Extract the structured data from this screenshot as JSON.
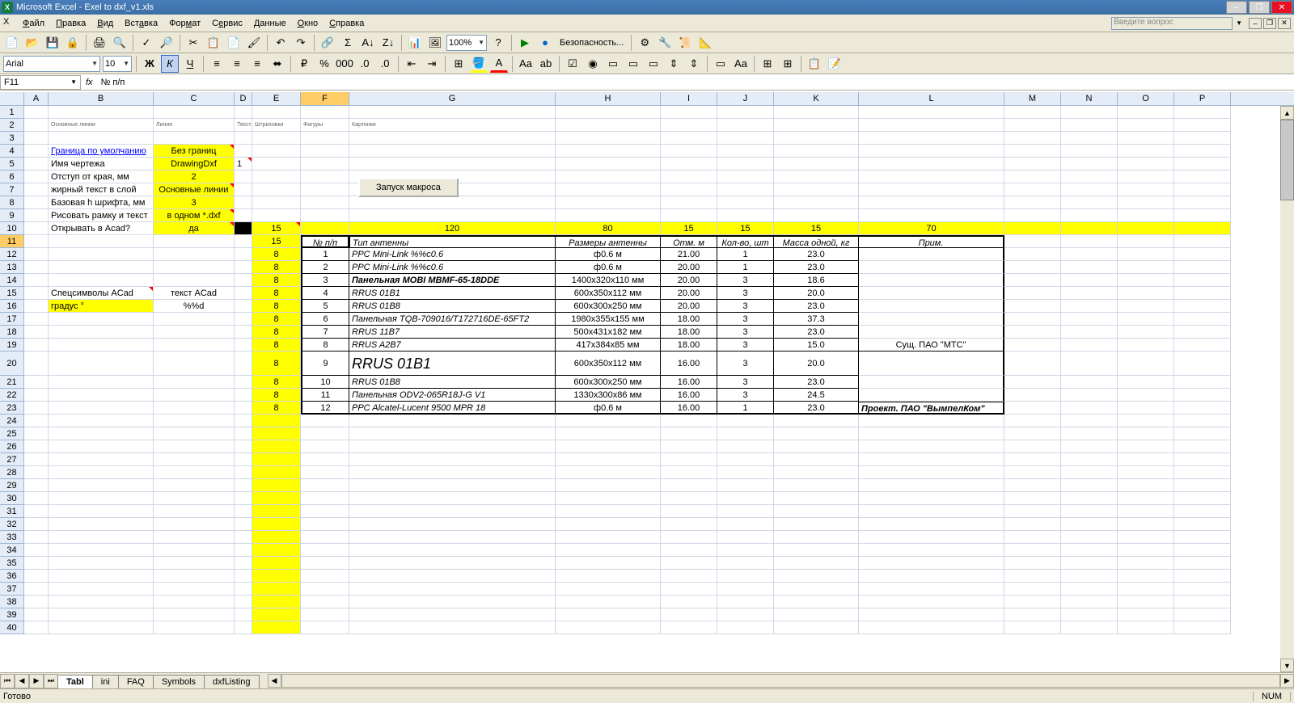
{
  "title": "Microsoft Excel - Exel to dxf_v1.xls",
  "menu": [
    "Файл",
    "Правка",
    "Вид",
    "Вставка",
    "Формат",
    "Сервис",
    "Данные",
    "Окно",
    "Справка"
  ],
  "question_placeholder": "Введите вопрос",
  "font_name": "Arial",
  "font_size": "10",
  "zoom": "100%",
  "security_label": "Безопасность...",
  "name_box": "F11",
  "formula": "№ п/п",
  "col_letters": [
    "A",
    "B",
    "C",
    "D",
    "E",
    "F",
    "G",
    "H",
    "I",
    "J",
    "K",
    "L",
    "M",
    "N",
    "O",
    "P"
  ],
  "tinyB2": "Основные линии",
  "tinyC2": "Линии",
  "tinyD2": "Текст",
  "tinyE2": "Штриховки",
  "tinyF2": "Фигуры",
  "tinyG2": "Картинки",
  "b4": "Граница по умолчанию",
  "c4": "Без границ",
  "b5": "Имя чертежа",
  "c5": "DrawingDxf",
  "d5": "1",
  "b6": "Отступ от края, мм",
  "c6": "2",
  "b7": "жирный текст в слой",
  "c7": "Основные линии",
  "b8": "Базовая h шрифта, мм",
  "c8": "3",
  "b9": "Рисовать рамку и текст",
  "c9": "в одном *.dxf",
  "b10": "Открывать в Acad?",
  "c10": "да",
  "b15": "Спецсимволы ACad",
  "c15": "текст ACad",
  "b16": "градус °",
  "c16": "%%d",
  "macro_button": "Запуск макроса",
  "e10": "15",
  "g10": "120",
  "h10": "80",
  "i10": "15",
  "j10": "15",
  "k10": "15",
  "l10": "70",
  "e11": "15",
  "e12": "8",
  "e13": "8",
  "e14": "8",
  "e15": "8",
  "e16": "8",
  "e17": "8",
  "e18": "8",
  "e19": "8",
  "e20": "8",
  "e21": "8",
  "e22": "8",
  "e23": "8",
  "hdr_f": "№ п/п",
  "hdr_g": "Тип антенны",
  "hdr_h": "Размеры антенны",
  "hdr_i": "Отм. м",
  "hdr_j": "Кол-во, шт",
  "hdr_k": "Масса одной, кг",
  "hdr_l": "Прим.",
  "r12": {
    "n": "1",
    "g": "PPC Mini-Link %%c0.6",
    "h": "ф0.6 м",
    "i": "21.00",
    "j": "1",
    "k": "23.0"
  },
  "r13": {
    "n": "2",
    "g": "PPC Mini-Link %%c0.6",
    "h": "ф0.6 м",
    "i": "20.00",
    "j": "1",
    "k": "23.0"
  },
  "r14": {
    "n": "3",
    "g": "Панельная MOBI MBMF-65-18DDE",
    "h": "1400x320x110 мм",
    "i": "20.00",
    "j": "3",
    "k": "18.6"
  },
  "r15": {
    "n": "4",
    "g": "RRUS 01B1",
    "h": "600x350x112 мм",
    "i": "20.00",
    "j": "3",
    "k": "20.0"
  },
  "r16": {
    "n": "5",
    "g": "RRUS 01B8",
    "h": "600x300x250 мм",
    "i": "20.00",
    "j": "3",
    "k": "23.0"
  },
  "r17": {
    "n": "6",
    "g": "Панельная TQB-709016/T172716DE-65FT2",
    "h": "1980x355x155 мм",
    "i": "18.00",
    "j": "3",
    "k": "37.3"
  },
  "r18": {
    "n": "7",
    "g": "RRUS 11B7",
    "h": "500x431x182 мм",
    "i": "18.00",
    "j": "3",
    "k": "23.0"
  },
  "r19": {
    "n": "8",
    "g": "RRUS A2B7",
    "h": "417x384x85 мм",
    "i": "18.00",
    "j": "3",
    "k": "15.0"
  },
  "r20": {
    "n": "9",
    "g": "RRUS 01B1",
    "h": "600x350x112 мм",
    "i": "16.00",
    "j": "3",
    "k": "20.0"
  },
  "r21": {
    "n": "10",
    "g": "RRUS 01B8",
    "h": "600x300x250 мм",
    "i": "16.00",
    "j": "3",
    "k": "23.0"
  },
  "r22": {
    "n": "11",
    "g": "Панельная ODV2-065R18J-G V1",
    "h": "1330x300x86 мм",
    "i": "16.00",
    "j": "3",
    "k": "24.5"
  },
  "r23": {
    "n": "12",
    "g": "PPC Alcatel-Lucent 9500 MPR 18",
    "h": "ф0.6 м",
    "i": "16.00",
    "j": "1",
    "k": "23.0"
  },
  "l19": "Сущ. ПАО \"МТС\"",
  "l23": "Проект. ПАО \"ВымпелКом\"",
  "sheet_tabs": [
    "Tabl",
    "ini",
    "FAQ",
    "Symbols",
    "dxfListing"
  ],
  "status": "Готово",
  "num_indicator": "NUM"
}
